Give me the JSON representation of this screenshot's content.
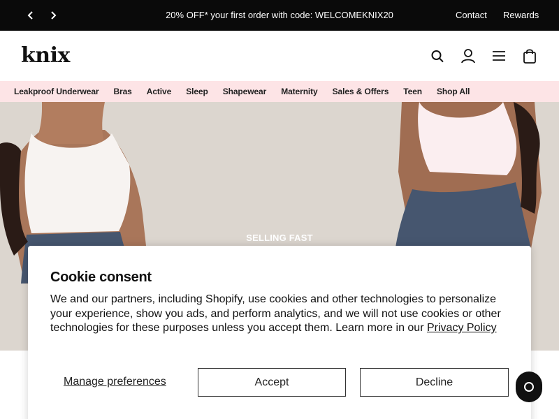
{
  "announcement": {
    "promo_text": "20% OFF* your first order with code: WELCOMEKNIX20",
    "prev_icon": "chevron-left-icon",
    "next_icon": "chevron-right-icon",
    "links": {
      "contact": "Contact",
      "rewards": "Rewards"
    }
  },
  "header": {
    "logo": "knix",
    "icons": [
      "search-icon",
      "user-icon",
      "menu-icon",
      "bag-icon"
    ]
  },
  "nav": {
    "items": [
      "Leakproof Underwear",
      "Bras",
      "Active",
      "Sleep",
      "Shapewear",
      "Maternity",
      "Sales & Offers",
      "Teen",
      "Shop All"
    ]
  },
  "hero": {
    "eyebrow": "SELLING FAST",
    "background_color": "#dcd6cf"
  },
  "cookie": {
    "title": "Cookie consent",
    "body": "We and our partners, including Shopify, use cookies and other technologies to personalize your experience, show you ads, and perform analytics, and we will not use cookies or other technologies for these purposes unless you accept them. Learn more in our ",
    "policy_link": "Privacy Policy",
    "manage_label": "Manage preferences",
    "accept_label": "Accept",
    "decline_label": "Decline"
  },
  "colors": {
    "announcement_bg": "#0a0a0a",
    "nav_bg": "#fde4e6",
    "accent_text": "#111111"
  }
}
